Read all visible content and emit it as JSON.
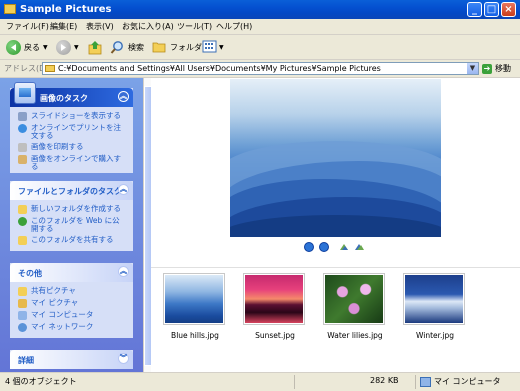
{
  "window": {
    "title": "Sample Pictures"
  },
  "menubar": [
    "ファイル(F)",
    "編集(E)",
    "表示(V)",
    "お気に入り(A)",
    "ツール(T)",
    "ヘルプ(H)"
  ],
  "toolbar": {
    "back_label": "戻る",
    "search_label": "検索",
    "folders_label": "フォルダ"
  },
  "address": {
    "label": "アドレス(D)",
    "value": "C:¥Documents and Settings¥All Users¥Documents¥My Pictures¥Sample Pictures",
    "go_label": "移動"
  },
  "sidebar": {
    "picture_tasks": {
      "title": "画像のタスク",
      "items": [
        "スライドショーを表示する",
        "オンラインでプリントを注文する",
        "画像を印刷する",
        "画像をオンラインで購入する"
      ]
    },
    "file_tasks": {
      "title": "ファイルとフォルダのタスク",
      "items": [
        "新しいフォルダを作成する",
        "このフォルダを Web に公開する",
        "このフォルダを共有する"
      ]
    },
    "other_places": {
      "title": "その他",
      "items": [
        "共有ピクチャ",
        "マイ ピクチャ",
        "マイ コンピュータ",
        "マイ ネットワーク"
      ]
    },
    "details": {
      "title": "詳細"
    }
  },
  "thumbnails": [
    {
      "name": "Blue hills.jpg",
      "selected": true
    },
    {
      "name": "Sunset.jpg",
      "selected": false
    },
    {
      "name": "Water lilies.jpg",
      "selected": false
    },
    {
      "name": "Winter.jpg",
      "selected": false
    }
  ],
  "status": {
    "objects": "4 個のオブジェクト",
    "size": "282 KB",
    "location": "マイ コンピュータ"
  }
}
